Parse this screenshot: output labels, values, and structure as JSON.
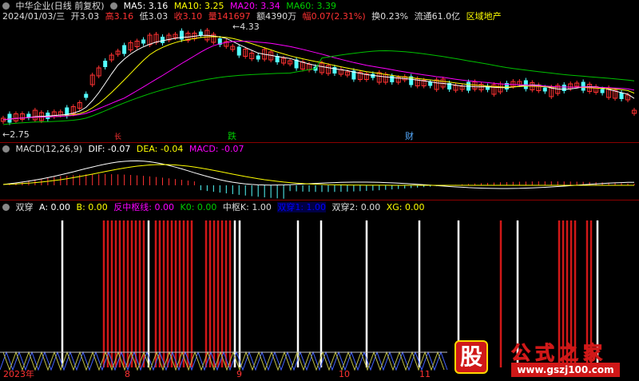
{
  "header": {
    "name": "中华企业(日线 前复权)",
    "ma5": "MA5: 3.16",
    "ma10": "MA10: 3.25",
    "ma20": "MA20: 3.34",
    "ma60": "MA60: 3.39"
  },
  "info": {
    "date": "2024/01/03/三",
    "open": "开3.03",
    "high": "高3.16",
    "low": "低3.03",
    "close": "收3.10",
    "vol": "量141697",
    "amt": "额4390万",
    "chg": "幅0.07(2.31%)",
    "turn": "换0.23%",
    "float": "流通61.0亿",
    "sector": "区域地产"
  },
  "price": {
    "max_label": "4.33",
    "min_label": "2.75",
    "markers": [
      {
        "text": "长"
      },
      {
        "text": "跌"
      },
      {
        "text": "财"
      }
    ]
  },
  "macd": {
    "title": "MACD(12,26,9)",
    "dif": "DIF: -0.07",
    "dea": "DEA: -0.04",
    "macd": "MACD: -0.07"
  },
  "indicator": {
    "title": "双穿",
    "a": "A: 0.00",
    "b": "B: 0.00",
    "fzs": "反中枢线: 0.00",
    "k0": "K0: 0.00",
    "zk": "中枢K: 1.00",
    "sc1": "双穿1: 1.00",
    "sc2": "双穿2: 0.00",
    "xg": "XG: 0.00"
  },
  "axis": {
    "labels": [
      "2023年",
      "8",
      "9",
      "10",
      "11"
    ]
  },
  "watermark": {
    "glyph": "股",
    "text": "公式之家",
    "url": "www.gszj100.com"
  },
  "colors": {
    "up": "#ff3232",
    "down": "#54ffff",
    "ma5": "#ffffff",
    "ma10": "#ffff00",
    "ma20": "#ff00ff",
    "ma60": "#00c000",
    "bar_red": "#d01818"
  }
}
